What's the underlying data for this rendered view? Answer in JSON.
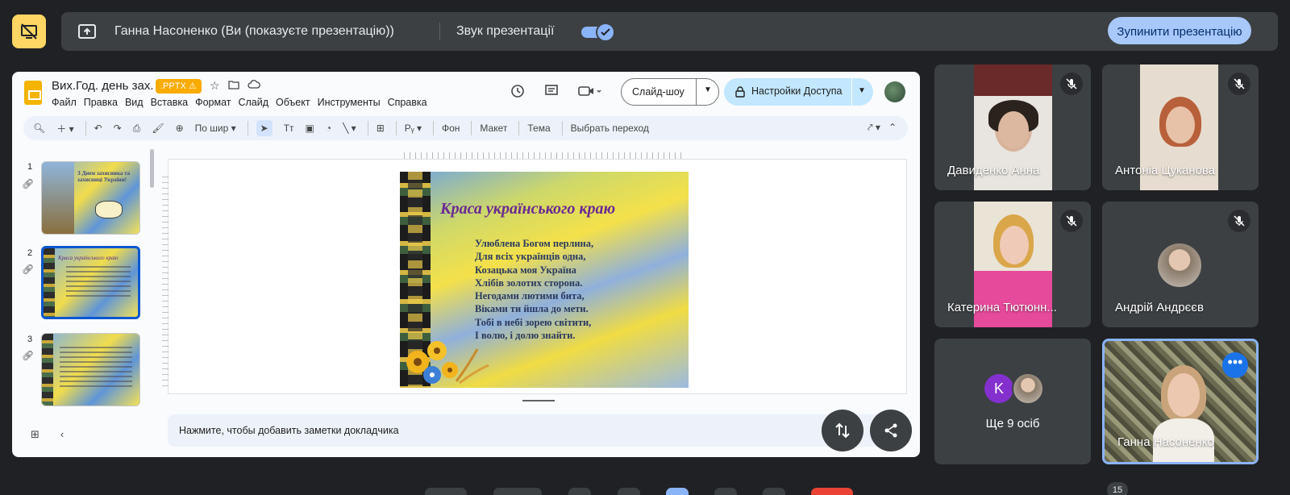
{
  "present_bar": {
    "presenter_name": "Ганна Насоненко (Ви (показуєте презентацію))",
    "sound_label": "Звук презентації",
    "stop_button": "Зупинити презентацію"
  },
  "slides_app": {
    "doc_title": "Вих.Год. день зах.",
    "file_badge": ".PPTX",
    "menu": [
      "Файл",
      "Правка",
      "Вид",
      "Вставка",
      "Формат",
      "Слайд",
      "Объект",
      "Инструменты",
      "Справка"
    ],
    "slideshow_button": "Слайд-шоу",
    "access_button": "Настройки Доступа",
    "toolbar": {
      "zoom": "По шир",
      "background": "Фон",
      "layout": "Макет",
      "theme": "Тема",
      "transition": "Выбрать переход"
    },
    "thumbnails": [
      {
        "number": "1",
        "caption": "З Днем захисника та захисниці України!"
      },
      {
        "number": "2",
        "caption": "Краса українського краю"
      },
      {
        "number": "3",
        "caption": ""
      }
    ],
    "slide": {
      "title": "Краса українського краю",
      "poem": [
        "Улюблена Богом перлина,",
        "Для всіх українців одна,",
        "Козацька моя Україна",
        "Хлібів золотих сторона.",
        "Негодами лютими бита,",
        "Віками ти йшла до мети.",
        "Тобі в небі зорею світити,",
        "І волю, і долю знайти."
      ]
    },
    "notes_placeholder": "Нажмите, чтобы добавить заметки докладчика"
  },
  "participants": [
    {
      "name": "Давиденко Анна",
      "muted": true
    },
    {
      "name": "Антоніа Цуканова",
      "muted": true
    },
    {
      "name": "Катерина Тютюнн...",
      "muted": true
    },
    {
      "name": "Андрій Андрєєв",
      "muted": true
    },
    {
      "name": "Ще 9 осіб",
      "avatar_letter": "K"
    },
    {
      "name": "Ганна Насоненко",
      "self": true
    }
  ],
  "participant_count": "15",
  "colors": {
    "background": "#202124",
    "bar": "#3c4043",
    "accent": "#8ab4f8",
    "stop_button": "#a8c7fa",
    "warning": "#fdd663"
  }
}
